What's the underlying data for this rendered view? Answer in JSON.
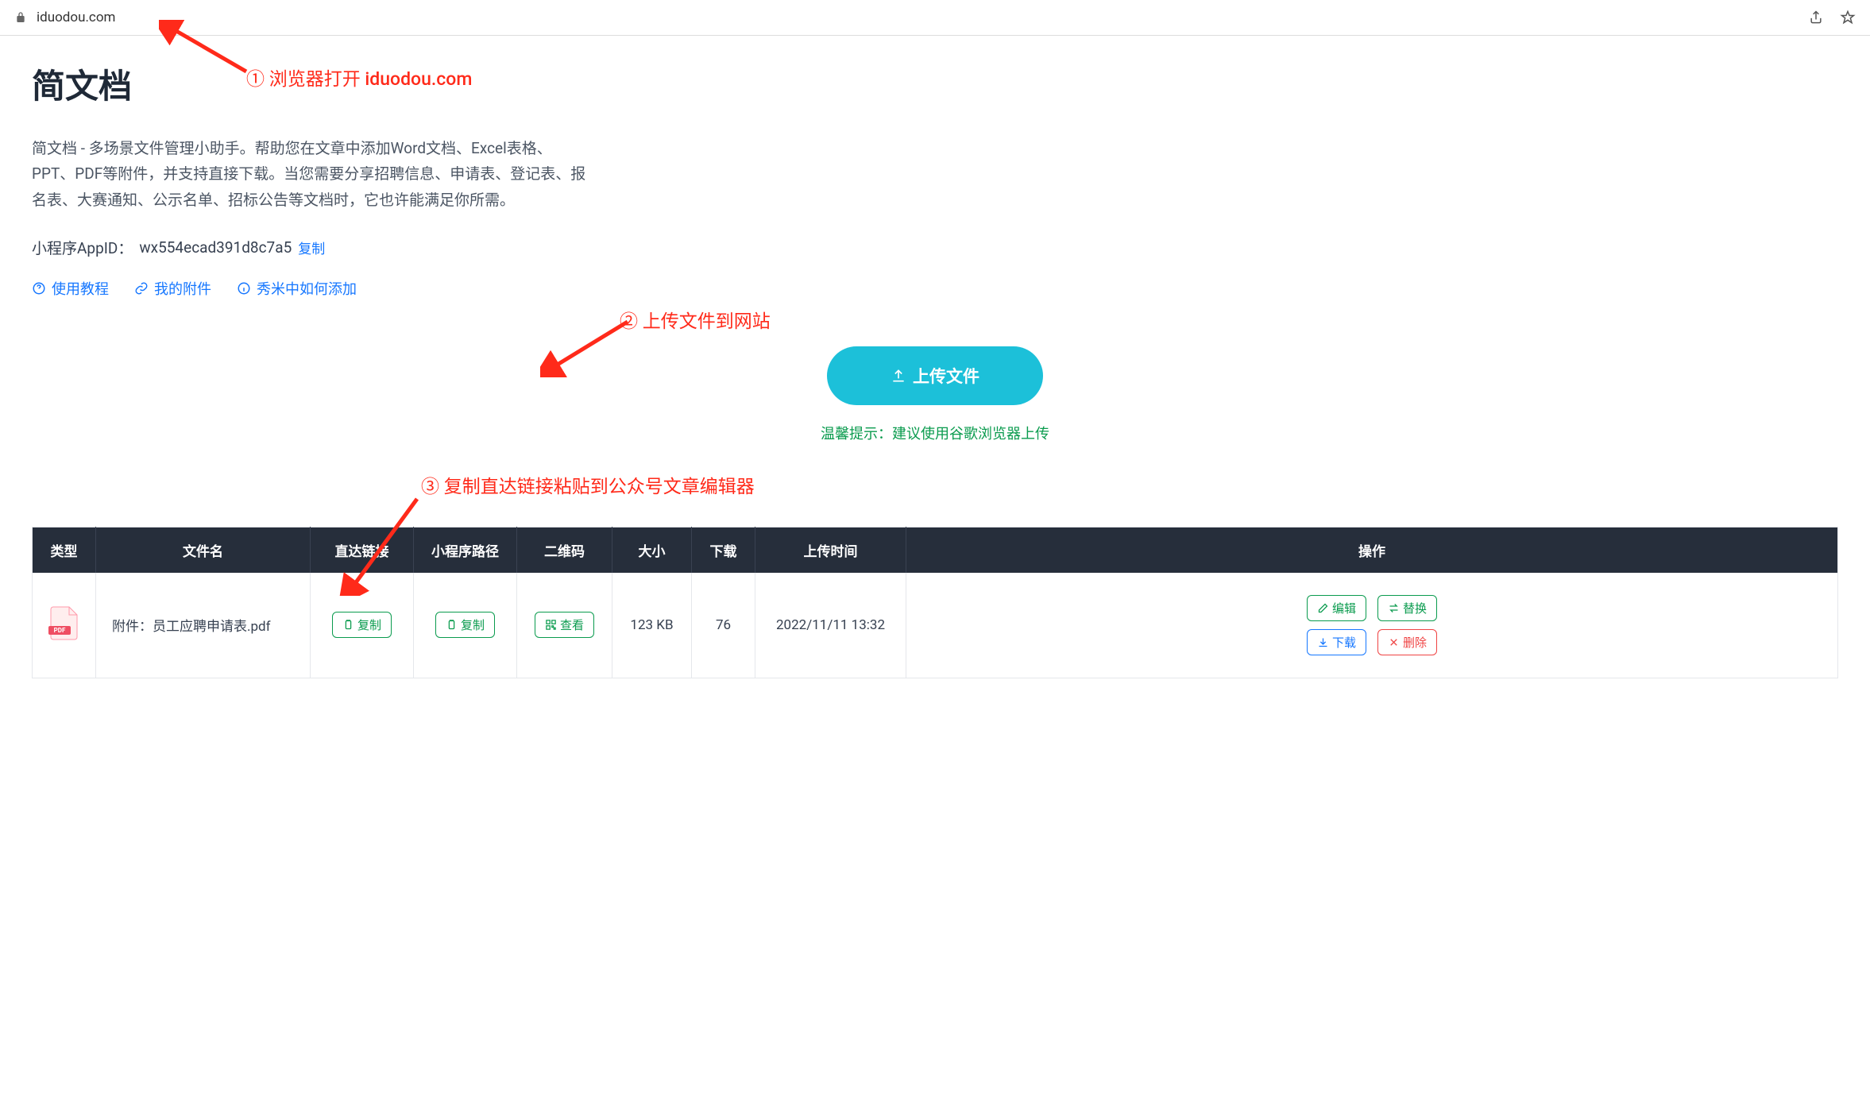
{
  "browser": {
    "url": "iduodou.com"
  },
  "header": {
    "title": "简文档",
    "description": "简文档 - 多场景文件管理小助手。帮助您在文章中添加Word文档、Excel表格、PPT、PDF等附件，并支持直接下载。当您需要分享招聘信息、申请表、登记表、报名表、大赛通知、公示名单、招标公告等文档时，它也许能满足你所需。",
    "appid_label": "小程序AppID：",
    "appid_value": "wx554ecad391d8c7a5",
    "copy_label": "复制",
    "links": {
      "tutorial": "使用教程",
      "my_files": "我的附件",
      "xiumi_help": "秀米中如何添加"
    }
  },
  "upload": {
    "button_label": "上传文件",
    "tip_prefix": "温馨提示：",
    "tip_text": "建议使用谷歌浏览器上传"
  },
  "table": {
    "headers": {
      "type": "类型",
      "filename": "文件名",
      "direct_link": "直达链接",
      "miniapp_path": "小程序路径",
      "qrcode": "二维码",
      "size": "大小",
      "downloads": "下载",
      "upload_time": "上传时间",
      "actions": "操作"
    },
    "buttons": {
      "copy": "复制",
      "view": "查看",
      "edit": "编辑",
      "replace": "替换",
      "download": "下载",
      "delete": "删除"
    },
    "rows": [
      {
        "type": "pdf",
        "filename": "附件：员工应聘申请表.pdf",
        "size": "123 KB",
        "downloads": "76",
        "upload_time": "2022/11/11 13:32"
      }
    ]
  },
  "annotations": {
    "step1": "① 浏览器打开  iduodou.com",
    "step2": "② 上传文件到网站",
    "step3": "③ 复制直达链接粘贴到公众号文章编辑器"
  }
}
